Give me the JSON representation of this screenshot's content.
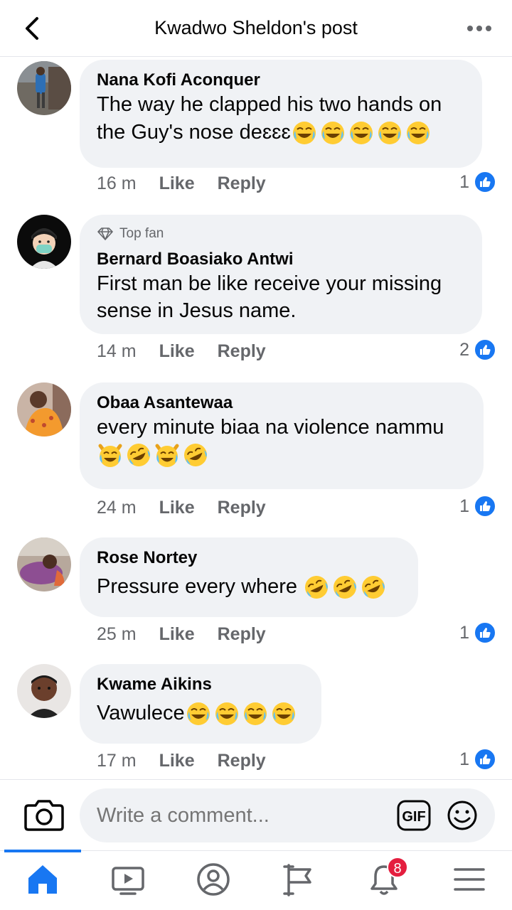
{
  "header": {
    "title": "Kwadwo Sheldon's post"
  },
  "comments": [
    {
      "author": "Nana Kofi Aconquer",
      "text_line1": "The way he clapped his two hands on",
      "text_line2": "the Guy's nose deɛɛɛ",
      "emojis": [
        "joy",
        "joy",
        "joy",
        "joy",
        "joy"
      ],
      "time": "16 m",
      "like": "Like",
      "reply": "Reply",
      "reactions": "1"
    },
    {
      "badge": "Top fan",
      "author": "Bernard Boasiako Antwi",
      "text_line1": "First man be like receive your missing",
      "text_line2": "sense in Jesus name.",
      "time": "14 m",
      "like": "Like",
      "reply": "Reply",
      "reactions": "2"
    },
    {
      "author": "Obaa Asantewaa",
      "text_line1": "every minute biaa na violence nammu",
      "emojis": [
        "crying-cat",
        "rofl",
        "crying-cat",
        "rofl"
      ],
      "time": "24 m",
      "like": "Like",
      "reply": "Reply",
      "reactions": "1"
    },
    {
      "author": "Rose Nortey",
      "text_line1": "Pressure every where ",
      "emojis": [
        "rofl",
        "rofl",
        "rofl"
      ],
      "time": "25 m",
      "like": "Like",
      "reply": "Reply",
      "reactions": "1"
    },
    {
      "author": "Kwame Aikins",
      "text_line1": "Vawulece",
      "emojis": [
        "joy",
        "joy",
        "joy",
        "joy"
      ],
      "time": "17 m",
      "like": "Like",
      "reply": "Reply",
      "reactions": "1"
    }
  ],
  "composer": {
    "placeholder": "Write a comment...",
    "gif_label": "GIF"
  },
  "nav": {
    "items": [
      "home-icon",
      "watch-icon",
      "profile-icon",
      "pages-icon",
      "notifications-icon",
      "menu-icon"
    ],
    "active": "home",
    "notification_count": "8"
  },
  "colors": {
    "accent": "#1877f2",
    "bubble": "#f0f2f5",
    "secondary_text": "#65676b",
    "badge": "#e41e3f"
  }
}
